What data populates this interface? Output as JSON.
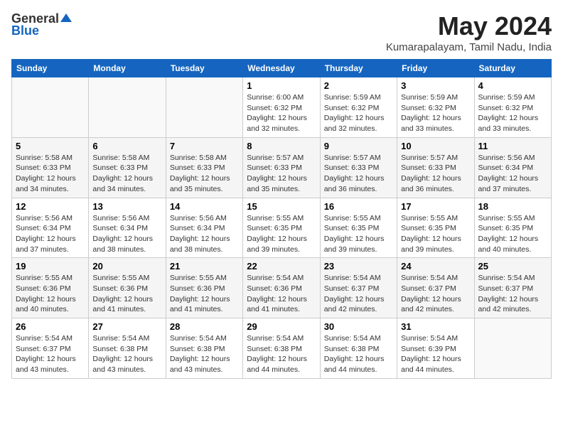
{
  "logo": {
    "general": "General",
    "blue": "Blue"
  },
  "title": "May 2024",
  "location": "Kumarapalayam, Tamil Nadu, India",
  "headers": [
    "Sunday",
    "Monday",
    "Tuesday",
    "Wednesday",
    "Thursday",
    "Friday",
    "Saturday"
  ],
  "weeks": [
    [
      {
        "day": "",
        "sunrise": "",
        "sunset": "",
        "daylight": ""
      },
      {
        "day": "",
        "sunrise": "",
        "sunset": "",
        "daylight": ""
      },
      {
        "day": "",
        "sunrise": "",
        "sunset": "",
        "daylight": ""
      },
      {
        "day": "1",
        "sunrise": "Sunrise: 6:00 AM",
        "sunset": "Sunset: 6:32 PM",
        "daylight": "Daylight: 12 hours and 32 minutes."
      },
      {
        "day": "2",
        "sunrise": "Sunrise: 5:59 AM",
        "sunset": "Sunset: 6:32 PM",
        "daylight": "Daylight: 12 hours and 32 minutes."
      },
      {
        "day": "3",
        "sunrise": "Sunrise: 5:59 AM",
        "sunset": "Sunset: 6:32 PM",
        "daylight": "Daylight: 12 hours and 33 minutes."
      },
      {
        "day": "4",
        "sunrise": "Sunrise: 5:59 AM",
        "sunset": "Sunset: 6:32 PM",
        "daylight": "Daylight: 12 hours and 33 minutes."
      }
    ],
    [
      {
        "day": "5",
        "sunrise": "Sunrise: 5:58 AM",
        "sunset": "Sunset: 6:33 PM",
        "daylight": "Daylight: 12 hours and 34 minutes."
      },
      {
        "day": "6",
        "sunrise": "Sunrise: 5:58 AM",
        "sunset": "Sunset: 6:33 PM",
        "daylight": "Daylight: 12 hours and 34 minutes."
      },
      {
        "day": "7",
        "sunrise": "Sunrise: 5:58 AM",
        "sunset": "Sunset: 6:33 PM",
        "daylight": "Daylight: 12 hours and 35 minutes."
      },
      {
        "day": "8",
        "sunrise": "Sunrise: 5:57 AM",
        "sunset": "Sunset: 6:33 PM",
        "daylight": "Daylight: 12 hours and 35 minutes."
      },
      {
        "day": "9",
        "sunrise": "Sunrise: 5:57 AM",
        "sunset": "Sunset: 6:33 PM",
        "daylight": "Daylight: 12 hours and 36 minutes."
      },
      {
        "day": "10",
        "sunrise": "Sunrise: 5:57 AM",
        "sunset": "Sunset: 6:33 PM",
        "daylight": "Daylight: 12 hours and 36 minutes."
      },
      {
        "day": "11",
        "sunrise": "Sunrise: 5:56 AM",
        "sunset": "Sunset: 6:34 PM",
        "daylight": "Daylight: 12 hours and 37 minutes."
      }
    ],
    [
      {
        "day": "12",
        "sunrise": "Sunrise: 5:56 AM",
        "sunset": "Sunset: 6:34 PM",
        "daylight": "Daylight: 12 hours and 37 minutes."
      },
      {
        "day": "13",
        "sunrise": "Sunrise: 5:56 AM",
        "sunset": "Sunset: 6:34 PM",
        "daylight": "Daylight: 12 hours and 38 minutes."
      },
      {
        "day": "14",
        "sunrise": "Sunrise: 5:56 AM",
        "sunset": "Sunset: 6:34 PM",
        "daylight": "Daylight: 12 hours and 38 minutes."
      },
      {
        "day": "15",
        "sunrise": "Sunrise: 5:55 AM",
        "sunset": "Sunset: 6:35 PM",
        "daylight": "Daylight: 12 hours and 39 minutes."
      },
      {
        "day": "16",
        "sunrise": "Sunrise: 5:55 AM",
        "sunset": "Sunset: 6:35 PM",
        "daylight": "Daylight: 12 hours and 39 minutes."
      },
      {
        "day": "17",
        "sunrise": "Sunrise: 5:55 AM",
        "sunset": "Sunset: 6:35 PM",
        "daylight": "Daylight: 12 hours and 39 minutes."
      },
      {
        "day": "18",
        "sunrise": "Sunrise: 5:55 AM",
        "sunset": "Sunset: 6:35 PM",
        "daylight": "Daylight: 12 hours and 40 minutes."
      }
    ],
    [
      {
        "day": "19",
        "sunrise": "Sunrise: 5:55 AM",
        "sunset": "Sunset: 6:36 PM",
        "daylight": "Daylight: 12 hours and 40 minutes."
      },
      {
        "day": "20",
        "sunrise": "Sunrise: 5:55 AM",
        "sunset": "Sunset: 6:36 PM",
        "daylight": "Daylight: 12 hours and 41 minutes."
      },
      {
        "day": "21",
        "sunrise": "Sunrise: 5:55 AM",
        "sunset": "Sunset: 6:36 PM",
        "daylight": "Daylight: 12 hours and 41 minutes."
      },
      {
        "day": "22",
        "sunrise": "Sunrise: 5:54 AM",
        "sunset": "Sunset: 6:36 PM",
        "daylight": "Daylight: 12 hours and 41 minutes."
      },
      {
        "day": "23",
        "sunrise": "Sunrise: 5:54 AM",
        "sunset": "Sunset: 6:37 PM",
        "daylight": "Daylight: 12 hours and 42 minutes."
      },
      {
        "day": "24",
        "sunrise": "Sunrise: 5:54 AM",
        "sunset": "Sunset: 6:37 PM",
        "daylight": "Daylight: 12 hours and 42 minutes."
      },
      {
        "day": "25",
        "sunrise": "Sunrise: 5:54 AM",
        "sunset": "Sunset: 6:37 PM",
        "daylight": "Daylight: 12 hours and 42 minutes."
      }
    ],
    [
      {
        "day": "26",
        "sunrise": "Sunrise: 5:54 AM",
        "sunset": "Sunset: 6:37 PM",
        "daylight": "Daylight: 12 hours and 43 minutes."
      },
      {
        "day": "27",
        "sunrise": "Sunrise: 5:54 AM",
        "sunset": "Sunset: 6:38 PM",
        "daylight": "Daylight: 12 hours and 43 minutes."
      },
      {
        "day": "28",
        "sunrise": "Sunrise: 5:54 AM",
        "sunset": "Sunset: 6:38 PM",
        "daylight": "Daylight: 12 hours and 43 minutes."
      },
      {
        "day": "29",
        "sunrise": "Sunrise: 5:54 AM",
        "sunset": "Sunset: 6:38 PM",
        "daylight": "Daylight: 12 hours and 44 minutes."
      },
      {
        "day": "30",
        "sunrise": "Sunrise: 5:54 AM",
        "sunset": "Sunset: 6:38 PM",
        "daylight": "Daylight: 12 hours and 44 minutes."
      },
      {
        "day": "31",
        "sunrise": "Sunrise: 5:54 AM",
        "sunset": "Sunset: 6:39 PM",
        "daylight": "Daylight: 12 hours and 44 minutes."
      },
      {
        "day": "",
        "sunrise": "",
        "sunset": "",
        "daylight": ""
      }
    ]
  ]
}
